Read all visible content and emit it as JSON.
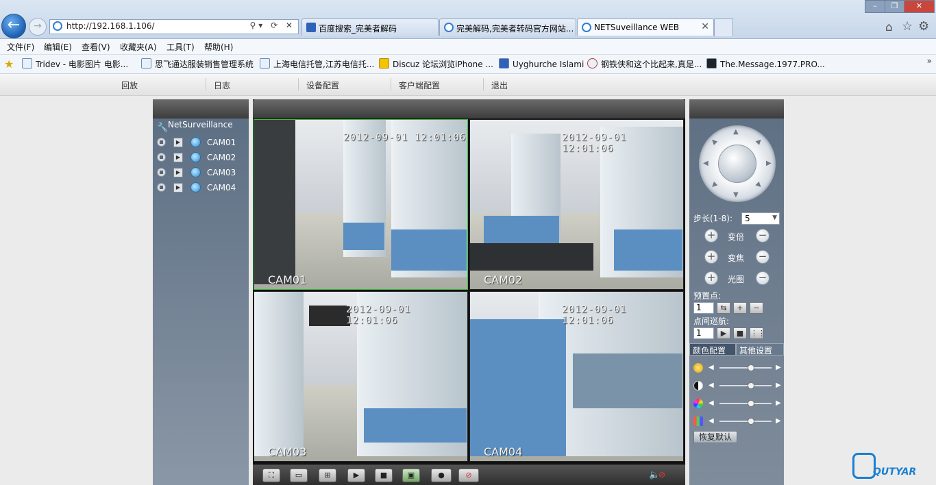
{
  "browser": {
    "url": "http://192.168.1.106/",
    "tabs": [
      {
        "label": "百度搜索_完美者解码",
        "active": false
      },
      {
        "label": "完美解码,完美者转码官方网站...",
        "active": false
      },
      {
        "label": "NETSuveillance WEB",
        "active": true
      }
    ],
    "tab_close": "✕",
    "menu": [
      "文件(F)",
      "编辑(E)",
      "查看(V)",
      "收藏夹(A)",
      "工具(T)",
      "帮助(H)"
    ],
    "favorites": [
      "Tridev - 电影图片 电影...",
      "思飞通达服装销售管理系统",
      "上海电信托管,江苏电信托...",
      "Discuz 论坛浏览iPhone ...",
      "Uyghurche Islami",
      "钢铁侠和这个比起来,真是...",
      "The.Message.1977.PRO..."
    ],
    "favorites_more": "»",
    "window_controls": [
      "–",
      "❐",
      "✕"
    ]
  },
  "nav": {
    "items": [
      "回放",
      "日志",
      "设备配置",
      "客户端配置",
      "退出"
    ]
  },
  "device_tree": {
    "root": "NetSurveillance",
    "cameras": [
      "CAM01",
      "CAM02",
      "CAM03",
      "CAM04"
    ]
  },
  "video": {
    "tiles": [
      {
        "timestamp": "2012-09-01 12:01:06",
        "name": "CAM01",
        "active": true
      },
      {
        "timestamp": "2012-09-01 12:01:06",
        "name": "CAM02",
        "active": false
      },
      {
        "timestamp": "2012-09-01 12:01:06",
        "name": "CAM03",
        "active": false
      },
      {
        "timestamp": "2012-09-01 12:01:06",
        "name": "CAM04",
        "active": false
      }
    ],
    "toolbar_icons": [
      "fullscreen-icon",
      "single-view-icon",
      "quad-view-icon",
      "play-all-icon",
      "stop-all-icon",
      "snapshot-icon",
      "record-icon",
      "stop-record-icon"
    ]
  },
  "ptz": {
    "step_label": "步长(1-8):",
    "step_value": "5",
    "zoom_label": "变倍",
    "focus_label": "变焦",
    "iris_label": "光圈",
    "preset_label": "预置点:",
    "preset_value": "1",
    "tour_label": "点间巡航:",
    "tour_value": "1"
  },
  "image_settings": {
    "tab_color": "颜色配置",
    "tab_other": "其他设置",
    "sliders": [
      {
        "name": "brightness",
        "level": 0.6
      },
      {
        "name": "contrast",
        "level": 0.6
      },
      {
        "name": "saturation",
        "level": 0.6
      },
      {
        "name": "hue",
        "level": 0.6
      }
    ],
    "reset_label": "恢复默认"
  },
  "logo": {
    "text": "QUTYAR"
  }
}
